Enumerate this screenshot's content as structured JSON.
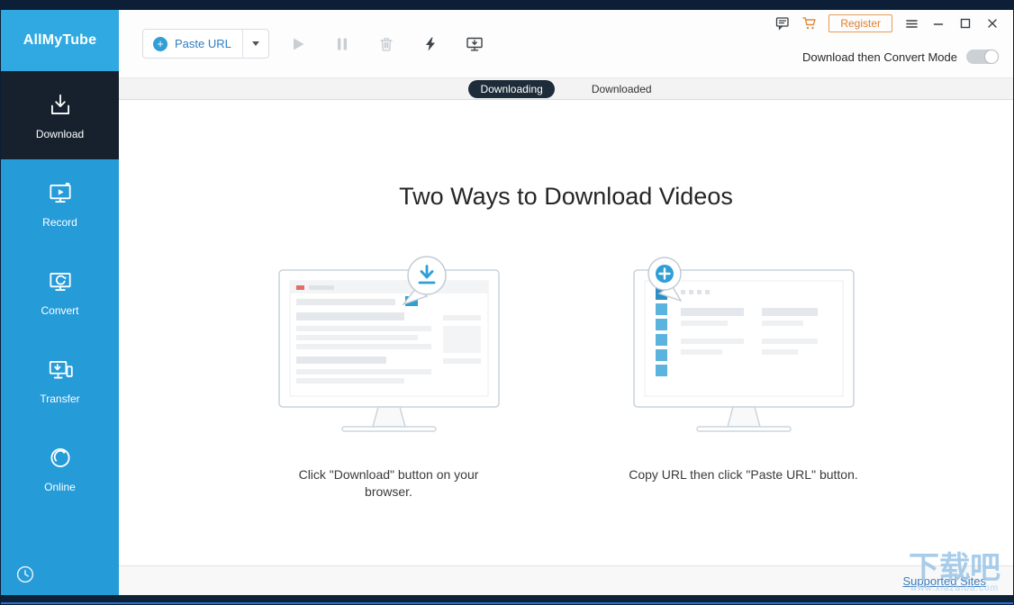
{
  "titlebar": {
    "register_label": "Register"
  },
  "sidebar": {
    "logo": "AllMyTube",
    "items": [
      {
        "label": "Download",
        "active": true
      },
      {
        "label": "Record",
        "active": false
      },
      {
        "label": "Convert",
        "active": false
      },
      {
        "label": "Transfer",
        "active": false
      },
      {
        "label": "Online",
        "active": false
      }
    ]
  },
  "toolbar": {
    "paste_url": "Paste URL",
    "mode_label": "Download then Convert Mode",
    "mode_enabled": false
  },
  "tabs": {
    "downloading": "Downloading",
    "downloaded": "Downloaded",
    "active_tab": "Downloading"
  },
  "content": {
    "heading": "Two Ways to Download Videos",
    "method_browser": "Click \"Download\" button on your browser.",
    "method_paste": "Copy URL then click \"Paste URL\" button."
  },
  "footer": {
    "supported_sites": "Supported Sites"
  },
  "watermark": {
    "title": "下载吧",
    "url": "www.xiazaiba.com"
  },
  "colors": {
    "sidebar_blue": "#259bd8",
    "accent_blue": "#2f9fd6",
    "dark_navy": "#0c1f36",
    "active_item": "#17212d",
    "register_orange": "#e07f2e"
  }
}
